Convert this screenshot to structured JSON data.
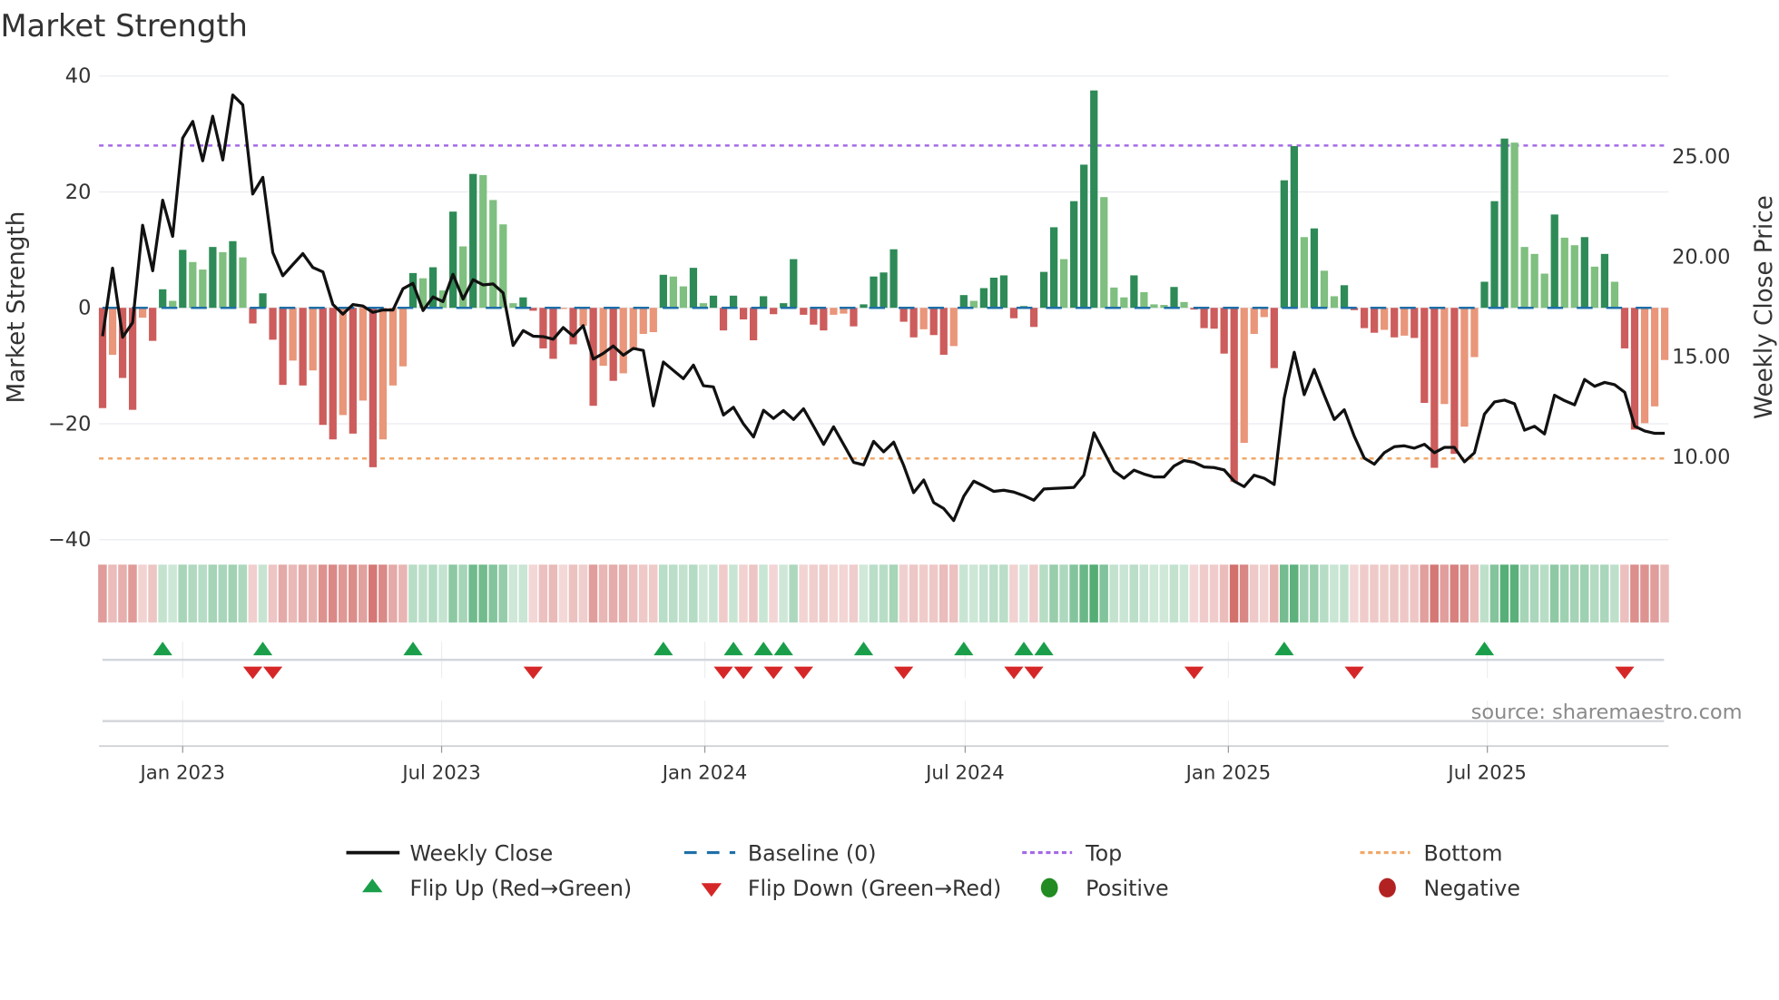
{
  "chart_data": {
    "type": "bar+line",
    "title": "Market Strength",
    "ylabel_left": "Market Strength",
    "ylabel_right": "Weekly Close Price",
    "ylim_left": [
      -40,
      40
    ],
    "ylim_right": [
      10,
      25
    ],
    "left_ticks": [
      {
        "v": 40,
        "label": "40"
      },
      {
        "v": 20,
        "label": "20"
      },
      {
        "v": 0,
        "label": "0"
      },
      {
        "v": -20,
        "label": "−20"
      },
      {
        "v": -40,
        "label": "−40"
      }
    ],
    "right_ticks": [
      {
        "v": 25,
        "label": "25.00"
      },
      {
        "v": 20,
        "label": "20.00"
      },
      {
        "v": 15,
        "label": "15.00"
      },
      {
        "v": 10,
        "label": "10.00"
      }
    ],
    "x_ticks": [
      {
        "date": "2023-01-01",
        "label": "Jan 2023"
      },
      {
        "date": "2023-07-01",
        "label": "Jul 2023"
      },
      {
        "date": "2024-01-01",
        "label": "Jan 2024"
      },
      {
        "date": "2024-07-01",
        "label": "Jul 2024"
      },
      {
        "date": "2025-01-01",
        "label": "Jan 2025"
      },
      {
        "date": "2025-07-01",
        "label": "Jul 2025"
      }
    ],
    "x_start": "2022-11-06",
    "x_step_days": 7,
    "top_level": 28,
    "bottom_level": -26,
    "baseline": 0,
    "strength": [
      -17.3,
      -8.1,
      -12.1,
      -17.6,
      -1.7,
      -5.7,
      3.2,
      1.2,
      10.0,
      7.9,
      6.6,
      10.5,
      9.6,
      11.5,
      8.7,
      -2.7,
      2.5,
      -5.5,
      -13.3,
      -9.1,
      -13.4,
      -10.8,
      -20.2,
      -22.7,
      -18.5,
      -21.7,
      -16.0,
      -27.5,
      -22.7,
      -13.4,
      -10.1,
      6.0,
      5.1,
      7.0,
      3.0,
      16.6,
      10.6,
      23.1,
      22.9,
      18.6,
      14.4,
      0.8,
      1.8,
      -0.5,
      -7.0,
      -8.8,
      -0.2,
      -6.3,
      -3.1,
      -16.9,
      -10.0,
      -12.6,
      -11.3,
      -7.1,
      -4.5,
      -4.2,
      5.7,
      5.4,
      3.7,
      6.9,
      0.8,
      2.1,
      -3.9,
      2.1,
      -2.0,
      -5.6,
      2.0,
      -1.1,
      0.8,
      8.4,
      -1.2,
      -2.9,
      -3.9,
      -1.2,
      -1.0,
      -3.2,
      0.6,
      5.4,
      6.1,
      10.1,
      -2.4,
      -5.1,
      -3.7,
      -4.7,
      -8.1,
      -6.6,
      2.2,
      1.2,
      3.4,
      5.2,
      5.6,
      -1.8,
      0.3,
      -3.3,
      6.2,
      13.9,
      8.4,
      18.4,
      24.7,
      37.5,
      19.1,
      3.5,
      1.8,
      5.6,
      2.7,
      0.6,
      0.5,
      3.6,
      1.0,
      -0.3,
      -3.5,
      -3.6,
      -7.9,
      -30.0,
      -23.3,
      -4.5,
      -1.6,
      -10.4,
      22.0,
      27.9,
      12.2,
      13.7,
      6.4,
      2.0,
      3.9,
      -0.4,
      -3.5,
      -4.3,
      -3.8,
      -5.1,
      -4.8,
      -5.2,
      -16.4,
      -27.6,
      -16.6,
      -25.2,
      -20.5,
      -8.5,
      4.5,
      18.4,
      29.2,
      28.5,
      10.5,
      9.3,
      5.9,
      16.1,
      12.1,
      10.8,
      12.2,
      7.1,
      9.3,
      4.5,
      -7.0,
      -21.0,
      -19.9,
      -17.0,
      -9.0
    ],
    "weekly_close": [
      15.97,
      19.37,
      15.92,
      16.65,
      21.51,
      19.24,
      22.76,
      20.95,
      25.86,
      26.69,
      24.73,
      26.95,
      24.77,
      28.01,
      27.52,
      23.07,
      23.9,
      20.15,
      18.99,
      19.55,
      20.09,
      19.4,
      19.18,
      17.55,
      17.07,
      17.55,
      17.48,
      17.16,
      17.28,
      17.28,
      18.34,
      18.61,
      17.25,
      17.93,
      17.7,
      19.06,
      17.82,
      18.79,
      18.53,
      18.58,
      18.13,
      15.51,
      16.25,
      15.97,
      15.95,
      15.82,
      16.4,
      15.97,
      16.5,
      14.83,
      15.11,
      15.48,
      15.02,
      15.36,
      15.26,
      12.49,
      14.68,
      14.26,
      13.85,
      14.53,
      13.5,
      13.44,
      12.04,
      12.42,
      11.59,
      10.94,
      12.27,
      11.86,
      12.26,
      11.81,
      12.35,
      11.48,
      10.57,
      11.45,
      10.57,
      9.67,
      9.55,
      10.72,
      10.2,
      10.68,
      9.52,
      8.16,
      8.79,
      7.66,
      7.37,
      6.77,
      7.98,
      8.73,
      8.49,
      8.22,
      8.28,
      8.19,
      8.01,
      7.78,
      8.34,
      8.37,
      8.39,
      8.42,
      9.03,
      11.15,
      10.2,
      9.25,
      8.88,
      9.28,
      9.09,
      8.94,
      8.94,
      9.49,
      9.76,
      9.67,
      9.44,
      9.41,
      9.29,
      8.73,
      8.46,
      9.03,
      8.88,
      8.57,
      12.87,
      15.17,
      13.05,
      14.31,
      13.02,
      11.81,
      12.3,
      10.98,
      9.88,
      9.58,
      10.15,
      10.45,
      10.5,
      10.38,
      10.57,
      10.15,
      10.42,
      10.42,
      9.7,
      10.15,
      12.08,
      12.69,
      12.78,
      12.6,
      11.28,
      11.47,
      11.09,
      13.02,
      12.75,
      12.54,
      13.81,
      13.47,
      13.66,
      13.55,
      13.17,
      11.48,
      11.24,
      11.12,
      11.12
    ],
    "legend": {
      "weekly_close": "Weekly Close",
      "baseline": "Baseline (0)",
      "top": "Top",
      "bottom": "Bottom",
      "flip_up": "Flip Up (Red→Green)",
      "flip_down": "Flip Down (Green→Red)",
      "positive": "Positive",
      "negative": "Negative"
    },
    "legend_placement": "bottom",
    "grid": true
  },
  "source": "source: sharemaestro.com",
  "colors": {
    "pos_strong": "#2e8b57",
    "pos_weak": "#7fbf7f",
    "neg_strong": "#cd5c5c",
    "neg_weak": "#e9967a",
    "top": "#a569e6",
    "bottom": "#f0a868",
    "baseline": "#1f6fa8",
    "flip_up": "#1a9e4a",
    "flip_down": "#d62728",
    "positive": "#228b22",
    "negative": "#b22222",
    "price": "#111111"
  }
}
